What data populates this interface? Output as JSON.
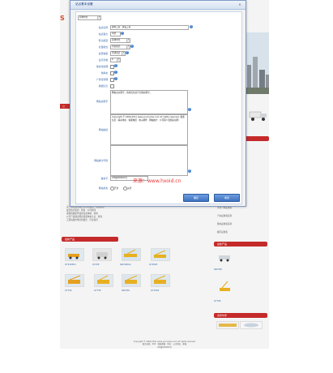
{
  "header": {
    "top_link": "留言",
    "logo": "S"
  },
  "left": {
    "news_tab": "公",
    "news_list": [
      "关于成立技术服务中心的通知 · 新浪新闻",
      "最近热点新闻 · 新闻 · 公司新闻",
      "采煤机械配件使用注意事项 · 新闻",
      "公司产品通过国家质量体系认证 · 新闻",
      "工程机械市场分析报告 · 行业资讯"
    ],
    "products_bar": "最新产品",
    "thumbs": [
      {
        "caption": "QY25K5D1"
      },
      {
        "caption": "QY25E"
      },
      {
        "caption": "SRC5000A"
      },
      {
        "caption": "QY50K5"
      },
      {
        "caption": "QY70K"
      },
      {
        "caption": "QY75E"
      },
      {
        "caption": "SRC550"
      },
      {
        "caption": "QY100K"
      }
    ]
  },
  "right": {
    "bar1": "联系我们",
    "bar2": "最新产品",
    "bar3": "合作伙伴",
    "items": [
      "大型汽车起重机",
      "汽车起重机系列",
      "随车起重机系列",
      "履带起重机"
    ],
    "product_caption_1": "SRC550",
    "product_caption_2": "QY70K"
  },
  "footer": {
    "line1": "Copyright © 2009-2011 www.yourname.com All rights reserved",
    "line2": "服务热线：400 · 客服邮箱 · 地址：公司地址 · 邮编",
    "line3": "ICP备000000号"
  },
  "dialog": {
    "title": "站点基本设置",
    "close": "×",
    "lang_select": "简体中文",
    "rows": {
      "site_name_label": "站点名称",
      "site_name_value": "建筑工程 · 建设工程",
      "site_lang_label": "站点语言",
      "site_lang_value": "中文",
      "default_model_label": "默认模型",
      "default_model_value": "简体中文",
      "item_style_label": "栏目模式",
      "item_style_value": "列表模式",
      "member_label": "会员等级",
      "member_value": "普通会员",
      "count_label": "显示条数",
      "count_value": "8",
      "static_label": "静态化处理",
      "rewrite_label": "伪静态",
      "ad_label": "广告位管理",
      "copy_label": "版权信息",
      "keywords_label": "网站关键字",
      "keywords_value": "网站主关键字，请用英文逗号分隔关键字。",
      "desc_label": "网站描述",
      "desc_value": "Copyright © 2009-2011 www.yourname.com All rights reserved. 备案信息 · 联系地址 · 客服电话 · 电子邮件 · 网站统计 · 公司简介及相关说明",
      "statcode_label": "网站统计代码",
      "icp_label": "备案号",
      "icp_value": "ICP备000000号",
      "status_label": "网站状态",
      "status_open": "开启",
      "status_close": "关闭"
    },
    "watermark": "来源：www.hxoid.cn",
    "ok_button": "确定",
    "cancel_button": "重置"
  }
}
